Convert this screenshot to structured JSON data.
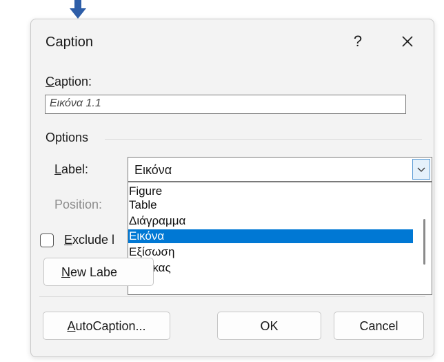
{
  "dialog": {
    "title": "Caption",
    "help_label": "?"
  },
  "caption": {
    "label_prefix": "C",
    "label_rest": "aption:",
    "value": "Εικόνα 1.1"
  },
  "options": {
    "heading": "Options",
    "label_label_prefix": "L",
    "label_label_rest": "abel:",
    "position_label": "Position:",
    "selected_label": "Εικόνα"
  },
  "dropdown": {
    "items": [
      "Figure",
      "Table",
      "Διάγραμμα",
      "Εικόνα",
      "Εξίσωση",
      "Πίνακας"
    ]
  },
  "exclude": {
    "label_prefix": "E",
    "label_rest": "xclude l"
  },
  "buttons": {
    "new_label_prefix": "N",
    "new_label_rest": "ew Labe",
    "autocaption_prefix": "A",
    "autocaption_rest": "utoCaption...",
    "ok": "OK",
    "cancel": "Cancel"
  },
  "colors": {
    "accent": "#0078d4",
    "arrow": "#2e5ea8"
  }
}
